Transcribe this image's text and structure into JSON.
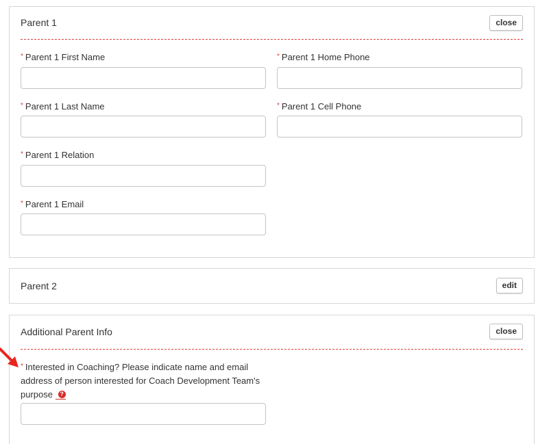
{
  "parent1": {
    "title": "Parent 1",
    "close_label": "close",
    "required_marker": "*",
    "fields": {
      "first_name": {
        "label": "Parent 1 First Name",
        "value": ""
      },
      "home_phone": {
        "label": "Parent 1 Home Phone",
        "value": ""
      },
      "last_name": {
        "label": "Parent 1 Last Name",
        "value": ""
      },
      "cell_phone": {
        "label": "Parent 1 Cell Phone",
        "value": ""
      },
      "relation": {
        "label": "Parent 1 Relation",
        "value": ""
      },
      "email": {
        "label": "Parent 1 Email",
        "value": ""
      }
    }
  },
  "parent2": {
    "title": "Parent 2",
    "edit_label": "edit"
  },
  "additional": {
    "title": "Additional Parent Info",
    "close_label": "close",
    "coaching": {
      "label_line1": "Interested in Coaching? Please indicate name and email",
      "label_line2": "address of person interested for Coach Development Team's",
      "label_line3": "purpose",
      "help_icon": "question-circle-icon",
      "value": ""
    }
  },
  "colors": {
    "required": "#e03a3a",
    "divider": "#e03a3a",
    "arrow": "#e8261e",
    "border": "#d6d6d6"
  }
}
